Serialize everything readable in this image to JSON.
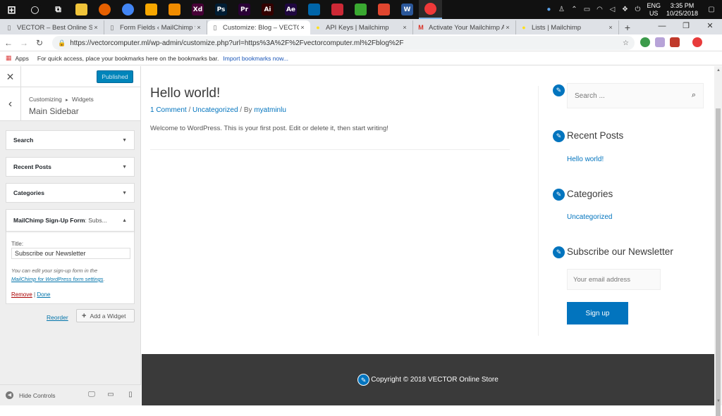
{
  "taskbar": {
    "apps": [
      {
        "icon": "windows-start-icon",
        "label": "",
        "color": "#111111"
      },
      {
        "icon": "search-circle-icon",
        "label": "",
        "color": "#111111"
      },
      {
        "icon": "task-view-icon",
        "label": "",
        "color": "#111111"
      },
      {
        "icon": "file-explorer-icon",
        "label": "",
        "color": "#f0c43a"
      },
      {
        "icon": "firefox-icon",
        "label": "",
        "color": "#e66000"
      },
      {
        "icon": "chrome-icon",
        "label": "",
        "color": "#4285f4"
      },
      {
        "icon": "torch-browser-icon",
        "label": "",
        "color": "#f7a700"
      },
      {
        "icon": "vlc-icon",
        "label": "",
        "color": "#f08c00"
      },
      {
        "icon": "adobe-xd-icon",
        "label": "Xd",
        "color": "#470137"
      },
      {
        "icon": "photoshop-icon",
        "label": "Ps",
        "color": "#001d34"
      },
      {
        "icon": "premiere-icon",
        "label": "Pr",
        "color": "#2a0036"
      },
      {
        "icon": "illustrator-icon",
        "label": "Ai",
        "color": "#330000"
      },
      {
        "icon": "after-effects-icon",
        "label": "Ae",
        "color": "#1f0740"
      },
      {
        "icon": "vscode-icon",
        "label": "",
        "color": "#0065a9"
      },
      {
        "icon": "zotero-icon",
        "label": "",
        "color": "#cc2936"
      },
      {
        "icon": "camtasia-icon",
        "label": "",
        "color": "#3aa831"
      },
      {
        "icon": "camstudio-icon",
        "label": "",
        "color": "#e0462f"
      },
      {
        "icon": "word-icon",
        "label": "W",
        "color": "#2b579a"
      },
      {
        "icon": "vivaldi-icon",
        "label": "",
        "color": "#ef3939"
      }
    ],
    "tray": {
      "language": "ENG",
      "region": "US",
      "time": "3:35 PM",
      "date": "10/25/2018"
    }
  },
  "browser": {
    "tabs": [
      {
        "title": "VECTOR – Best Online Store in",
        "icon": "page-icon",
        "active": false
      },
      {
        "title": "Form Fields ‹ MailChimp for",
        "icon": "page-icon",
        "active": false
      },
      {
        "title": "Customize: Blog – VECTOR",
        "icon": "page-icon",
        "active": true
      },
      {
        "title": "API Keys | Mailchimp",
        "icon": "mailchimp-icon",
        "active": false
      },
      {
        "title": "Activate Your Mailchimp Acc",
        "icon": "gmail-icon",
        "active": false
      },
      {
        "title": "Lists | Mailchimp",
        "icon": "mailchimp-icon",
        "active": false
      }
    ],
    "url": "https://vectorcomputer.ml/wp-admin/customize.php?url=https%3A%2F%2Fvectorcomputer.ml%2Fblog%2F",
    "bookmarks": {
      "apps_label": "Apps",
      "hint": "For quick access, place your bookmarks here on the bookmarks bar.",
      "import_link": "Import bookmarks now..."
    }
  },
  "customizer": {
    "publish_label": "Published",
    "breadcrumb_root": "Customizing",
    "breadcrumb_sep": "▸",
    "breadcrumb_parent": "Widgets",
    "section_title": "Main Sidebar",
    "widgets": [
      {
        "title": "Search"
      },
      {
        "title": "Recent Posts"
      },
      {
        "title": "Categories"
      }
    ],
    "mailchimp_widget": {
      "title": "MailChimp Sign-Up Form",
      "subtitle": ": Subs...",
      "field_label": "Title:",
      "field_value": "Subscribe our Newsletter",
      "desc_text": "You can edit your sign-up form in the",
      "desc_link": "MailChimp for WordPress form settings",
      "desc_end": ".",
      "remove_label": "Remove",
      "separator": "|",
      "done_label": "Done"
    },
    "reorder_label": "Reorder",
    "add_widget_label": "Add a Widget",
    "hide_controls_label": "Hide Controls"
  },
  "preview": {
    "post": {
      "title": "Hello world!",
      "comments_link": "1 Comment",
      "meta_sep1": " / ",
      "category_link": "Uncategorized",
      "meta_sep2": " / By ",
      "author_link": "myatminlu",
      "excerpt": "Welcome to WordPress. This is your first post. Edit or delete it, then start writing!"
    },
    "sidebar": {
      "search_placeholder": "Search ...",
      "recent_posts_heading": "Recent Posts",
      "recent_post_link": "Hello world!",
      "categories_heading": "Categories",
      "category_link": "Uncategorized",
      "subscribe_heading": "Subscribe our Newsletter",
      "email_placeholder": "Your email address",
      "signup_label": "Sign up"
    },
    "footer": {
      "copyright": "Copyright © 2018 VECTOR Online Store"
    }
  },
  "colors": {
    "accent": "#0274be",
    "wp_blue": "#0085ba",
    "footer_bg": "#3a3a3a"
  }
}
